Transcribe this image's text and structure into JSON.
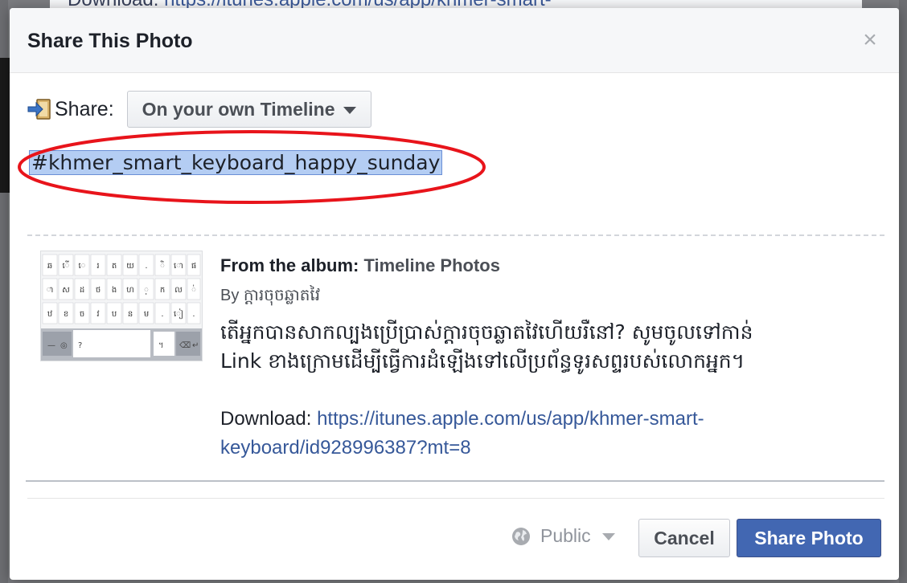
{
  "background": {
    "page_text_prefix": "Download: ",
    "page_link_fragment": "https://itunes.apple.com/us/app/khmer-smart-"
  },
  "dialog": {
    "title": "Share This Photo",
    "close_glyph": "×"
  },
  "share": {
    "label": "Share:",
    "audience": "On your own Timeline",
    "icon": "share-arrow-icon"
  },
  "message": {
    "hashtag": "#khmer_smart_keyboard_happy_sunday",
    "highlight_color": "#e8141b"
  },
  "attachment": {
    "album_prefix": "From the album:",
    "album_name": "Timeline Photos",
    "by_prefix": "By",
    "author": "ក្ដារចុចឆ្លាតវៃ",
    "text_line1": "តើអ្នកបានសាកល្បងប្រើប្រាស់ក្ដារចុចឆ្លាតវៃហើយរឺនៅ? សូមចូលទៅកាន់",
    "text_line2": "Link ខាងក្រោមដើម្បីធ្វើការដំឡើងទៅលើប្រព័ន្ធទូរសព្ទរបស់លោកអ្នក។",
    "download_label": "Download:",
    "download_url": "https://itunes.apple.com/us/app/khmer-smart-keyboard/id928996387?mt=8",
    "thumbnail": "khmer-keyboard-screenshot"
  },
  "footer": {
    "privacy_label": "Public",
    "privacy_icon": "globe-icon",
    "cancel_label": "Cancel",
    "submit_label": "Share Photo"
  },
  "colors": {
    "primary": "#4267b2",
    "link": "#365899",
    "selection": "#b4cdf3"
  }
}
